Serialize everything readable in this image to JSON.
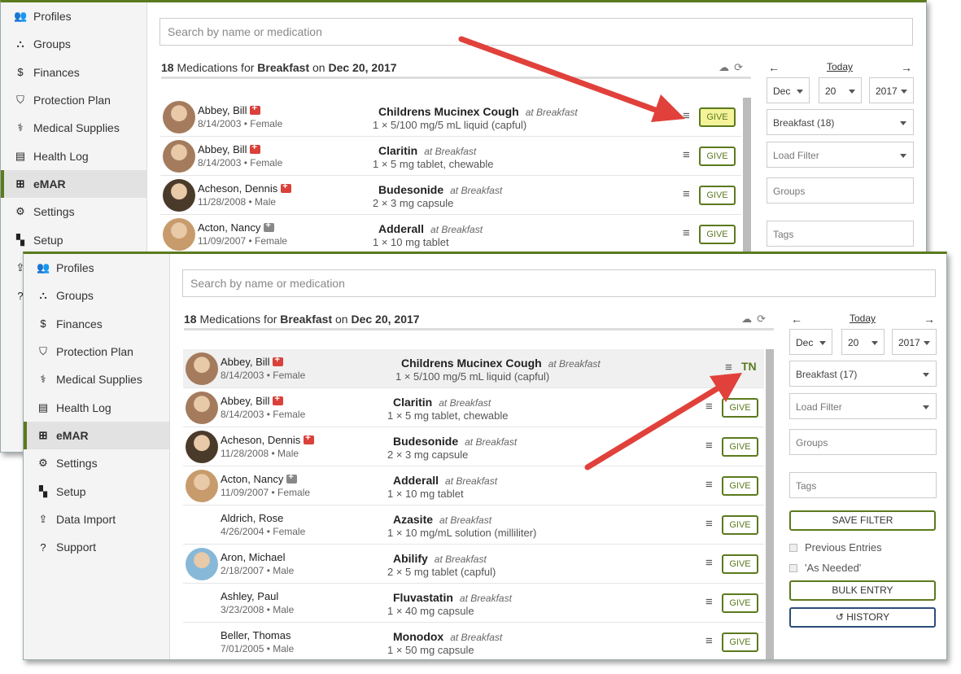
{
  "colors": {
    "accent": "#5b7a1e",
    "arrow": "#e0413a",
    "give_highlight": "#f4f39a"
  },
  "nav": [
    {
      "label": "Profiles",
      "icon": "users-icon",
      "glyph": "👥"
    },
    {
      "label": "Groups",
      "icon": "sitemap-icon",
      "glyph": "⛬"
    },
    {
      "label": "Finances",
      "icon": "dollar-icon",
      "glyph": "$"
    },
    {
      "label": "Protection Plan",
      "icon": "shield-icon",
      "glyph": "⛉"
    },
    {
      "label": "Medical Supplies",
      "icon": "stethoscope-icon",
      "glyph": "⚕"
    },
    {
      "label": "Health Log",
      "icon": "book-icon",
      "glyph": "▤"
    },
    {
      "label": "eMAR",
      "icon": "medkit-icon",
      "glyph": "⊞",
      "active": true
    },
    {
      "label": "Settings",
      "icon": "gear-icon",
      "glyph": "⚙"
    },
    {
      "label": "Setup",
      "icon": "map-icon",
      "glyph": "▚"
    },
    {
      "label": "Data Import",
      "icon": "upload-icon",
      "glyph": "⇪"
    },
    {
      "label": "Support",
      "icon": "question-icon",
      "glyph": "?"
    }
  ],
  "search_placeholder": "Search by name or medication",
  "header": {
    "count": "18",
    "text1": "Medications for",
    "meal": "Breakfast",
    "text2": "on",
    "date": "Dec 20, 2017"
  },
  "date_nav": {
    "prev": "←",
    "today": "Today",
    "next": "→",
    "month": "Dec",
    "day": "20",
    "year": "2017"
  },
  "window_top": {
    "meal_filter": "Breakfast (18)",
    "rows": [
      {
        "name": "Abbey, Bill",
        "info": "8/14/2003 • Female",
        "badge": "red",
        "med": "Childrens Mucinex Cough",
        "at": "at Breakfast",
        "dose": "1 × 5/100 mg/5 mL liquid (capful)",
        "action": "GIVE",
        "highlight_button": true
      },
      {
        "name": "Abbey, Bill",
        "info": "8/14/2003 • Female",
        "badge": "red",
        "med": "Claritin",
        "at": "at Breakfast",
        "dose": "1 × 5 mg tablet, chewable",
        "action": "GIVE"
      },
      {
        "name": "Acheson, Dennis",
        "info": "11/28/2008 • Male",
        "badge": "red",
        "med": "Budesonide",
        "at": "at Breakfast",
        "dose": "2 × 3 mg capsule",
        "action": "GIVE"
      },
      {
        "name": "Acton, Nancy",
        "info": "11/09/2007 • Female",
        "badge": "gray",
        "med": "Adderall",
        "at": "at Breakfast",
        "dose": "1 × 10 mg tablet",
        "action": "GIVE"
      }
    ]
  },
  "window_bottom": {
    "meal_filter": "Breakfast (17)",
    "rows": [
      {
        "name": "Abbey, Bill",
        "info": "8/14/2003 • Female",
        "badge": "red",
        "med": "Childrens Mucinex Cough",
        "at": "at Breakfast",
        "dose": "1 × 5/100 mg/5 mL liquid (capful)",
        "action": "TN",
        "highlight_row": true
      },
      {
        "name": "Abbey, Bill",
        "info": "8/14/2003 • Female",
        "badge": "red",
        "med": "Claritin",
        "at": "at Breakfast",
        "dose": "1 × 5 mg tablet, chewable",
        "action": "GIVE"
      },
      {
        "name": "Acheson, Dennis",
        "info": "11/28/2008 • Male",
        "badge": "red",
        "med": "Budesonide",
        "at": "at Breakfast",
        "dose": "2 × 3 mg capsule",
        "action": "GIVE"
      },
      {
        "name": "Acton, Nancy",
        "info": "11/09/2007 • Female",
        "badge": "gray",
        "med": "Adderall",
        "at": "at Breakfast",
        "dose": "1 × 10 mg tablet",
        "action": "GIVE"
      },
      {
        "name": "Aldrich, Rose",
        "info": "4/26/2004 • Female",
        "badge": "",
        "med": "Azasite",
        "at": "at Breakfast",
        "dose": "1 × 10 mg/mL solution (milliliter)",
        "action": "GIVE",
        "no_avatar": true
      },
      {
        "name": "Aron, Michael",
        "info": "2/18/2007 • Male",
        "badge": "",
        "med": "Abilify",
        "at": "at Breakfast",
        "dose": "2 × 5 mg tablet (capful)",
        "action": "GIVE"
      },
      {
        "name": "Ashley, Paul",
        "info": "3/23/2008 • Male",
        "badge": "",
        "med": "Fluvastatin",
        "at": "at Breakfast",
        "dose": "1 × 40 mg capsule",
        "action": "GIVE",
        "no_avatar": true
      },
      {
        "name": "Beller, Thomas",
        "info": "7/01/2005 • Male",
        "badge": "",
        "med": "Monodox",
        "at": "at Breakfast",
        "dose": "1 × 50 mg capsule",
        "action": "GIVE",
        "no_avatar": true
      }
    ]
  },
  "filters": {
    "load_filter": "Load Filter",
    "groups": "Groups",
    "tags": "Tags",
    "save_filter": "SAVE FILTER",
    "previous_entries": "Previous Entries",
    "as_needed": "'As Needed'",
    "bulk_entry": "BULK ENTRY",
    "history": "HISTORY",
    "history_glyph": "↺"
  }
}
